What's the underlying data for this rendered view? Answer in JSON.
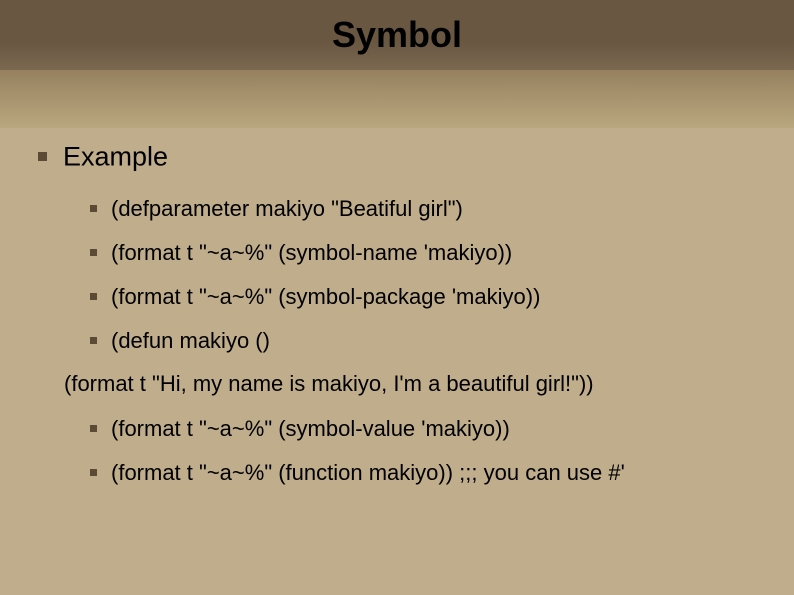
{
  "title": "Symbol",
  "heading": "Example",
  "items": [
    "(defparameter makiyo \"Beatiful girl\")",
    "(format t \"~a~%\" (symbol-name 'makiyo))",
    "(format t \"~a~%\" (symbol-package 'makiyo))",
    "(defun makiyo ()"
  ],
  "wrapped_line": "(format t \"Hi, my name is makiyo, I'm a beautiful girl!\"))",
  "items2": [
    "(format t \"~a~%\" (symbol-value 'makiyo))",
    "(format t \"~a~%\" (function makiyo)) ;;; you can use #'"
  ]
}
